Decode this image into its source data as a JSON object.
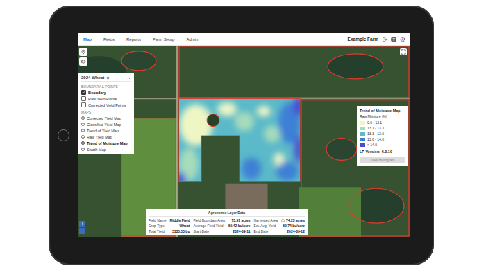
{
  "nav": {
    "tabs": [
      {
        "label": "Map",
        "selected": true
      },
      {
        "label": "Fields",
        "selected": false
      },
      {
        "label": "Reports",
        "selected": false
      },
      {
        "label": "Farm Setup",
        "selected": false
      },
      {
        "label": "Admin",
        "selected": false
      }
    ],
    "farm": "Example Farm",
    "help": "?"
  },
  "layer_panel": {
    "title": "2024-Wheat",
    "sections": [
      {
        "heading": "BOUNDARY & POINTS",
        "items": [
          {
            "label": "Boundary",
            "kind": "checkbox",
            "checked": true
          },
          {
            "label": "Raw Yield Points",
            "kind": "checkbox",
            "checked": false
          },
          {
            "label": "Corrected Yield Points",
            "kind": "checkbox",
            "checked": false
          }
        ]
      },
      {
        "heading": "MAPS",
        "items": [
          {
            "label": "Corrected Yield Map",
            "kind": "radio",
            "selected": false
          },
          {
            "label": "Classified Yield Map",
            "kind": "radio",
            "selected": false
          },
          {
            "label": "Trend of Yield Map",
            "kind": "radio",
            "selected": false
          },
          {
            "label": "Raw Yield Map",
            "kind": "radio",
            "selected": false
          },
          {
            "label": "Trend of Moisture Map",
            "kind": "radio",
            "selected": true
          },
          {
            "label": "Swath Map",
            "kind": "radio",
            "selected": false
          }
        ]
      }
    ]
  },
  "zoom": [
    "+",
    "−"
  ],
  "legend": {
    "title": "Trend of Moisture Map",
    "subtitle": "Raw Moisture (%)",
    "items": [
      {
        "label": "0.0 - 13.1",
        "color": "#eef6c4"
      },
      {
        "label": "13.1 - 13.3",
        "color": "#a6dcbc"
      },
      {
        "label": "13.3 - 13.6",
        "color": "#5bb9c9"
      },
      {
        "label": "13.6 - 14.0",
        "color": "#3d80d6"
      },
      {
        "label": "> 14.0",
        "color": "#4b4bcf"
      }
    ],
    "version": "LP Version: 6.0.10",
    "button": {
      "label": "View Histogram",
      "disabled": true
    }
  },
  "agronomic_table": {
    "title": "Agronomic Layer Data",
    "rows": [
      [
        {
          "label": "Field Name",
          "value": "Middle Field",
          "info": false
        },
        {
          "label": "Field Boundary Area",
          "value": "73.91 acres",
          "info": false
        },
        {
          "label": "Harvested Area",
          "value": "74.23 acres",
          "info": true
        }
      ],
      [
        {
          "label": "Crop Type",
          "value": "Wheat",
          "info": false
        },
        {
          "label": "Average Field Yield",
          "value": "69.42 bu/acre",
          "info": false
        },
        {
          "label": "Est. Avg. Yield",
          "value": "69.74 bu/acre",
          "info": false
        }
      ],
      [
        {
          "label": "Total Yield",
          "value": "5135.55 bu",
          "info": false
        },
        {
          "label": "Start Date",
          "value": "2024-09-11",
          "info": false
        },
        {
          "label": "End Date",
          "value": "2024-09-12",
          "info": false
        }
      ]
    ]
  }
}
